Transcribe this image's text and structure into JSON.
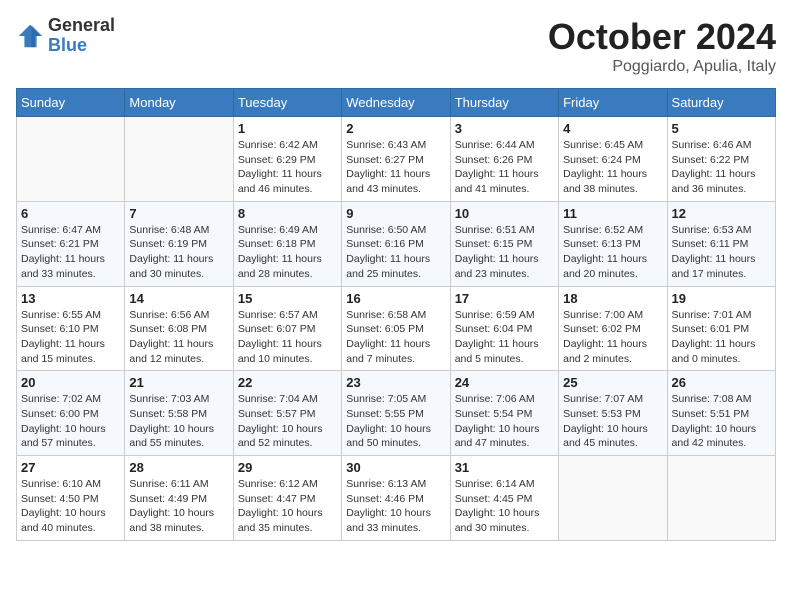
{
  "logo": {
    "general": "General",
    "blue": "Blue"
  },
  "title": "October 2024",
  "subtitle": "Poggiardo, Apulia, Italy",
  "days_of_week": [
    "Sunday",
    "Monday",
    "Tuesday",
    "Wednesday",
    "Thursday",
    "Friday",
    "Saturday"
  ],
  "weeks": [
    [
      {
        "day": "",
        "info": ""
      },
      {
        "day": "",
        "info": ""
      },
      {
        "day": "1",
        "info": "Sunrise: 6:42 AM\nSunset: 6:29 PM\nDaylight: 11 hours and 46 minutes."
      },
      {
        "day": "2",
        "info": "Sunrise: 6:43 AM\nSunset: 6:27 PM\nDaylight: 11 hours and 43 minutes."
      },
      {
        "day": "3",
        "info": "Sunrise: 6:44 AM\nSunset: 6:26 PM\nDaylight: 11 hours and 41 minutes."
      },
      {
        "day": "4",
        "info": "Sunrise: 6:45 AM\nSunset: 6:24 PM\nDaylight: 11 hours and 38 minutes."
      },
      {
        "day": "5",
        "info": "Sunrise: 6:46 AM\nSunset: 6:22 PM\nDaylight: 11 hours and 36 minutes."
      }
    ],
    [
      {
        "day": "6",
        "info": "Sunrise: 6:47 AM\nSunset: 6:21 PM\nDaylight: 11 hours and 33 minutes."
      },
      {
        "day": "7",
        "info": "Sunrise: 6:48 AM\nSunset: 6:19 PM\nDaylight: 11 hours and 30 minutes."
      },
      {
        "day": "8",
        "info": "Sunrise: 6:49 AM\nSunset: 6:18 PM\nDaylight: 11 hours and 28 minutes."
      },
      {
        "day": "9",
        "info": "Sunrise: 6:50 AM\nSunset: 6:16 PM\nDaylight: 11 hours and 25 minutes."
      },
      {
        "day": "10",
        "info": "Sunrise: 6:51 AM\nSunset: 6:15 PM\nDaylight: 11 hours and 23 minutes."
      },
      {
        "day": "11",
        "info": "Sunrise: 6:52 AM\nSunset: 6:13 PM\nDaylight: 11 hours and 20 minutes."
      },
      {
        "day": "12",
        "info": "Sunrise: 6:53 AM\nSunset: 6:11 PM\nDaylight: 11 hours and 17 minutes."
      }
    ],
    [
      {
        "day": "13",
        "info": "Sunrise: 6:55 AM\nSunset: 6:10 PM\nDaylight: 11 hours and 15 minutes."
      },
      {
        "day": "14",
        "info": "Sunrise: 6:56 AM\nSunset: 6:08 PM\nDaylight: 11 hours and 12 minutes."
      },
      {
        "day": "15",
        "info": "Sunrise: 6:57 AM\nSunset: 6:07 PM\nDaylight: 11 hours and 10 minutes."
      },
      {
        "day": "16",
        "info": "Sunrise: 6:58 AM\nSunset: 6:05 PM\nDaylight: 11 hours and 7 minutes."
      },
      {
        "day": "17",
        "info": "Sunrise: 6:59 AM\nSunset: 6:04 PM\nDaylight: 11 hours and 5 minutes."
      },
      {
        "day": "18",
        "info": "Sunrise: 7:00 AM\nSunset: 6:02 PM\nDaylight: 11 hours and 2 minutes."
      },
      {
        "day": "19",
        "info": "Sunrise: 7:01 AM\nSunset: 6:01 PM\nDaylight: 11 hours and 0 minutes."
      }
    ],
    [
      {
        "day": "20",
        "info": "Sunrise: 7:02 AM\nSunset: 6:00 PM\nDaylight: 10 hours and 57 minutes."
      },
      {
        "day": "21",
        "info": "Sunrise: 7:03 AM\nSunset: 5:58 PM\nDaylight: 10 hours and 55 minutes."
      },
      {
        "day": "22",
        "info": "Sunrise: 7:04 AM\nSunset: 5:57 PM\nDaylight: 10 hours and 52 minutes."
      },
      {
        "day": "23",
        "info": "Sunrise: 7:05 AM\nSunset: 5:55 PM\nDaylight: 10 hours and 50 minutes."
      },
      {
        "day": "24",
        "info": "Sunrise: 7:06 AM\nSunset: 5:54 PM\nDaylight: 10 hours and 47 minutes."
      },
      {
        "day": "25",
        "info": "Sunrise: 7:07 AM\nSunset: 5:53 PM\nDaylight: 10 hours and 45 minutes."
      },
      {
        "day": "26",
        "info": "Sunrise: 7:08 AM\nSunset: 5:51 PM\nDaylight: 10 hours and 42 minutes."
      }
    ],
    [
      {
        "day": "27",
        "info": "Sunrise: 6:10 AM\nSunset: 4:50 PM\nDaylight: 10 hours and 40 minutes."
      },
      {
        "day": "28",
        "info": "Sunrise: 6:11 AM\nSunset: 4:49 PM\nDaylight: 10 hours and 38 minutes."
      },
      {
        "day": "29",
        "info": "Sunrise: 6:12 AM\nSunset: 4:47 PM\nDaylight: 10 hours and 35 minutes."
      },
      {
        "day": "30",
        "info": "Sunrise: 6:13 AM\nSunset: 4:46 PM\nDaylight: 10 hours and 33 minutes."
      },
      {
        "day": "31",
        "info": "Sunrise: 6:14 AM\nSunset: 4:45 PM\nDaylight: 10 hours and 30 minutes."
      },
      {
        "day": "",
        "info": ""
      },
      {
        "day": "",
        "info": ""
      }
    ]
  ]
}
